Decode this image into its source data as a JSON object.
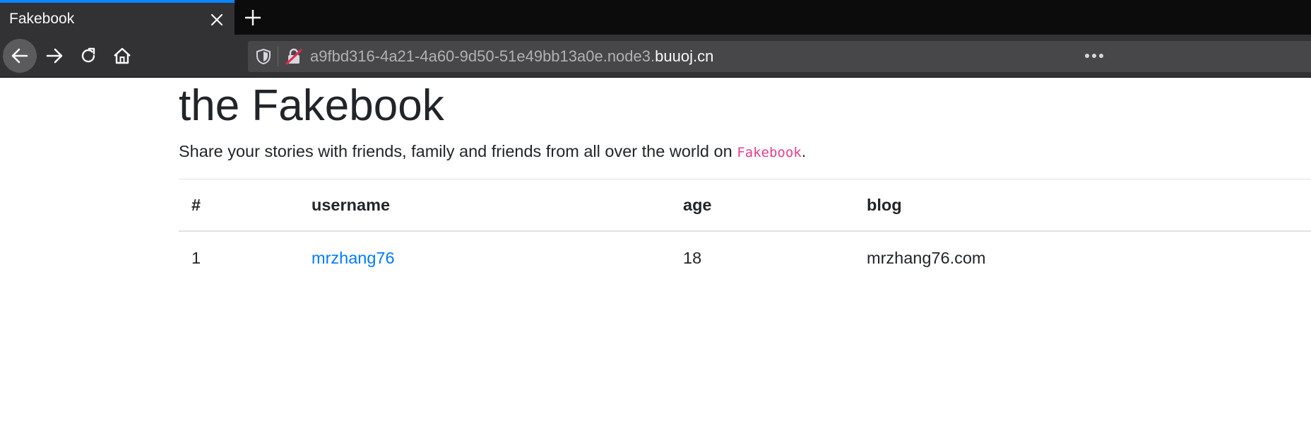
{
  "browser": {
    "tab": {
      "title": "Fakebook"
    },
    "url": {
      "host_dim": "a9fbd316-4a21-4a60-9d50-51e49bb13a0e.node3.",
      "host_main": "buuoj.cn"
    },
    "icons": {
      "close": "close-icon",
      "new_tab": "plus-icon",
      "back": "arrow-left-icon",
      "forward": "arrow-right-icon",
      "reload": "reload-icon",
      "home": "home-icon",
      "tracking": "shield-icon",
      "insecure": "lock-struck-icon",
      "menu": "ellipsis-icon"
    },
    "colors": {
      "tab_accent": "#0a84ff",
      "chrome_bg": "#323234",
      "tabbar_bg": "#0c0c0d"
    }
  },
  "page": {
    "title": "the Fakebook",
    "lead_text": "Share your stories with friends, family and friends from all over the world on ",
    "lead_code": "Fakebook",
    "lead_end": ".",
    "table": {
      "headers": [
        "#",
        "username",
        "age",
        "blog"
      ],
      "rows": [
        {
          "num": "1",
          "username": "mrzhang76",
          "age": "18",
          "blog": "mrzhang76.com"
        }
      ]
    },
    "colors": {
      "link": "#007bff",
      "code": "#e83e8c"
    }
  }
}
